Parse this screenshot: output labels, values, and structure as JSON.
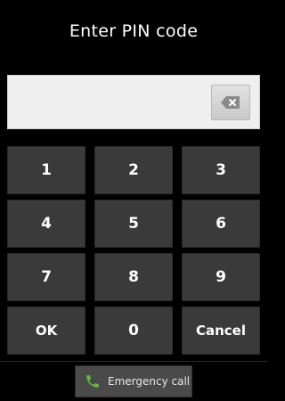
{
  "title": "Enter PIN code",
  "pin": {
    "value": ""
  },
  "keypad": {
    "keys": [
      {
        "label": "1"
      },
      {
        "label": "2"
      },
      {
        "label": "3"
      },
      {
        "label": "4"
      },
      {
        "label": "5"
      },
      {
        "label": "6"
      },
      {
        "label": "7"
      },
      {
        "label": "8"
      },
      {
        "label": "9"
      },
      {
        "label": "OK"
      },
      {
        "label": "0"
      },
      {
        "label": "Cancel"
      }
    ]
  },
  "emergency": {
    "label": "Emergency call",
    "icon": "phone-icon",
    "icon_color": "#5fbf3a"
  },
  "icons": {
    "backspace": "backspace-icon"
  },
  "colors": {
    "background": "#000000",
    "key": "#3a3a3a",
    "pin_field": "#efefef"
  }
}
